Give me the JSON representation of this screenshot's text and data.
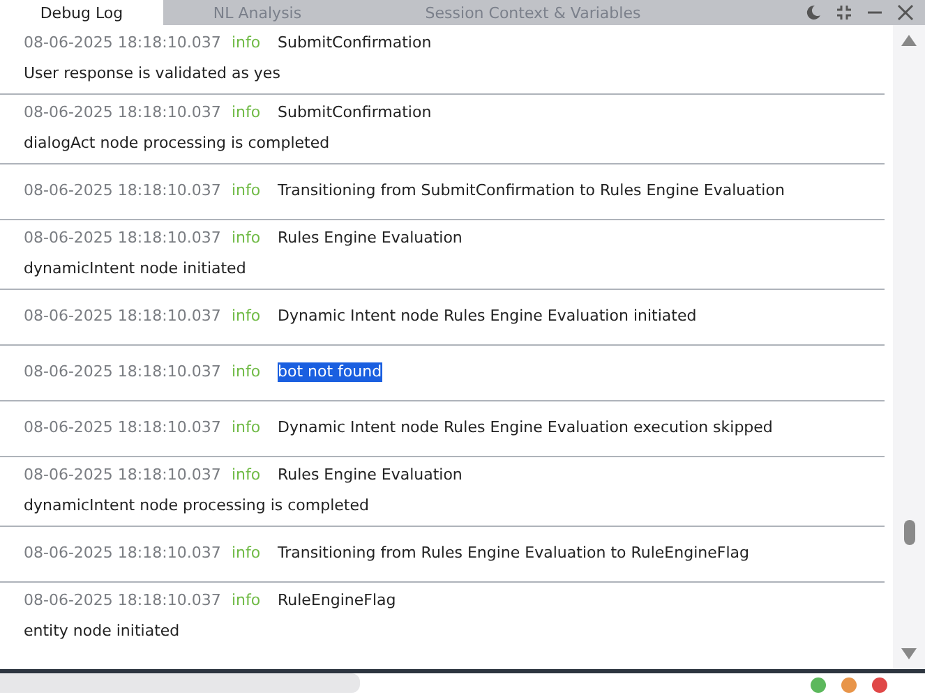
{
  "tabs": [
    {
      "label": "Debug Log",
      "selected": true
    },
    {
      "label": "NL Analysis",
      "selected": false
    },
    {
      "label": "Session Context & Variables",
      "selected": false
    }
  ],
  "log_entries": [
    {
      "timestamp": "08-06-2025 18:18:10.037",
      "level": "info",
      "title": "SubmitConfirmation",
      "highlighted": false,
      "detail": "User response is validated as yes"
    },
    {
      "timestamp": "08-06-2025 18:18:10.037",
      "level": "info",
      "title": "SubmitConfirmation",
      "highlighted": false,
      "detail": "dialogAct node processing is completed"
    },
    {
      "timestamp": "08-06-2025 18:18:10.037",
      "level": "info",
      "title": "Transitioning from SubmitConfirmation to Rules Engine Evaluation",
      "highlighted": false
    },
    {
      "timestamp": "08-06-2025 18:18:10.037",
      "level": "info",
      "title": "Rules Engine Evaluation",
      "highlighted": false,
      "detail": "dynamicIntent node initiated"
    },
    {
      "timestamp": "08-06-2025 18:18:10.037",
      "level": "info",
      "title": "Dynamic Intent node Rules Engine Evaluation initiated",
      "highlighted": false
    },
    {
      "timestamp": "08-06-2025 18:18:10.037",
      "level": "info",
      "title": "bot not found",
      "highlighted": true
    },
    {
      "timestamp": "08-06-2025 18:18:10.037",
      "level": "info",
      "title": "Dynamic Intent node Rules Engine Evaluation execution skipped",
      "highlighted": false
    },
    {
      "timestamp": "08-06-2025 18:18:10.037",
      "level": "info",
      "title": "Rules Engine Evaluation",
      "highlighted": false,
      "detail": "dynamicIntent node processing is completed"
    },
    {
      "timestamp": "08-06-2025 18:18:10.037",
      "level": "info",
      "title": "Transitioning from Rules Engine Evaluation to RuleEngineFlag",
      "highlighted": false
    },
    {
      "timestamp": "08-06-2025 18:18:10.037",
      "level": "info",
      "title": "RuleEngineFlag",
      "highlighted": false,
      "detail": "entity node initiated"
    }
  ],
  "status_dots": [
    {
      "color": "#5cb85c"
    },
    {
      "color": "#e8954a"
    },
    {
      "color": "#e04848"
    }
  ]
}
